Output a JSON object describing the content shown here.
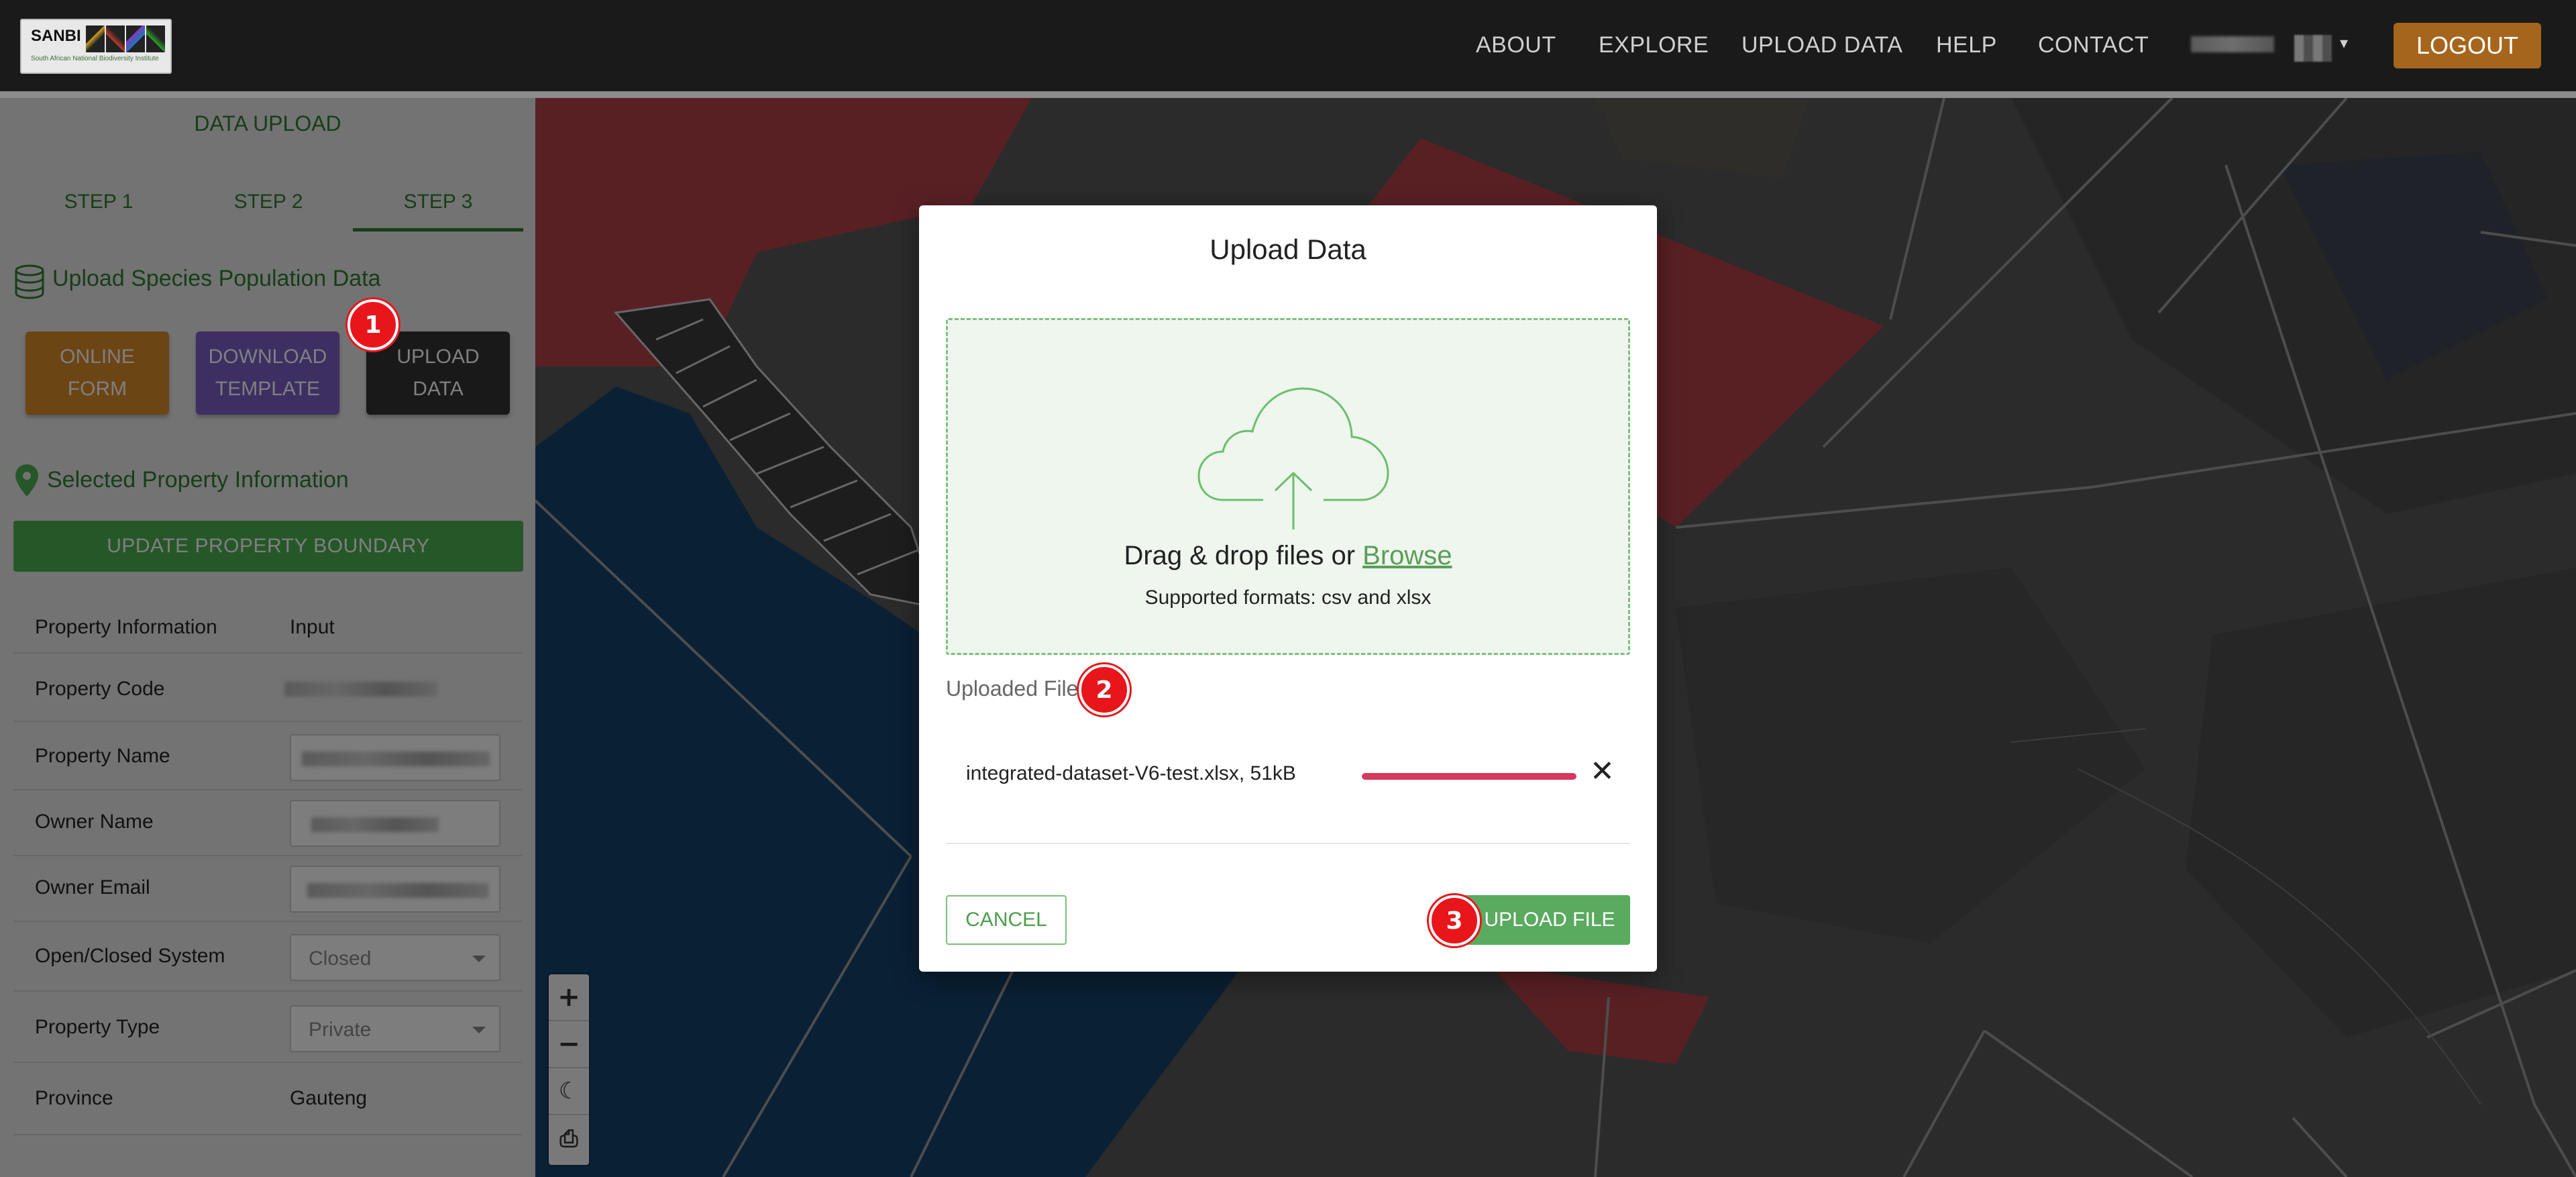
{
  "header": {
    "logo_text": "SANBI",
    "logo_subtitle": "South African National Biodiversity Institute",
    "nav": [
      "ABOUT",
      "EXPLORE",
      "UPLOAD DATA",
      "HELP",
      "CONTACT"
    ],
    "logout_label": "LOGOUT"
  },
  "sidebar": {
    "title": "DATA UPLOAD",
    "steps": [
      "STEP 1",
      "STEP 2",
      "STEP 3"
    ],
    "active_step": "STEP 3",
    "upload_section_title": "Upload Species Population Data",
    "buttons": {
      "online_form": "ONLINE FORM",
      "download_template": "DOWNLOAD TEMPLATE",
      "upload_data": "UPLOAD DATA"
    },
    "property_section_title": "Selected Property Information",
    "update_boundary_label": "UPDATE PROPERTY BOUNDARY",
    "table_headers": [
      "Property Information",
      "Input"
    ],
    "rows": [
      {
        "label": "Property Code"
      },
      {
        "label": "Property Name"
      },
      {
        "label": "Owner Name"
      },
      {
        "label": "Owner Email"
      },
      {
        "label": "Open/Closed System",
        "value": "Closed"
      },
      {
        "label": "Property Type",
        "value": "Private"
      },
      {
        "label": "Province",
        "value": "Gauteng"
      }
    ]
  },
  "map": {
    "controls": [
      "zoom-in",
      "zoom-out",
      "theme",
      "print"
    ]
  },
  "modal": {
    "title": "Upload Data",
    "drop_text": "Drag & drop files or ",
    "browse_label": "Browse",
    "supported_formats": "Supported formats: csv and xlsx",
    "uploaded_file_label": "Uploaded File",
    "file_info": "integrated-dataset-V6-test.xlsx, 51kB",
    "progress": 1.0,
    "cancel_label": "CANCEL",
    "upload_label": "UPLOAD FILE"
  },
  "badges": [
    "1",
    "2",
    "3"
  ],
  "colors": {
    "accent_green": "#4caf50",
    "logout": "#a6651c",
    "online_form": "#d98a2b",
    "download_template": "#7b5ec4",
    "badge_red": "#e8161b",
    "progress_red": "#d6385e"
  }
}
